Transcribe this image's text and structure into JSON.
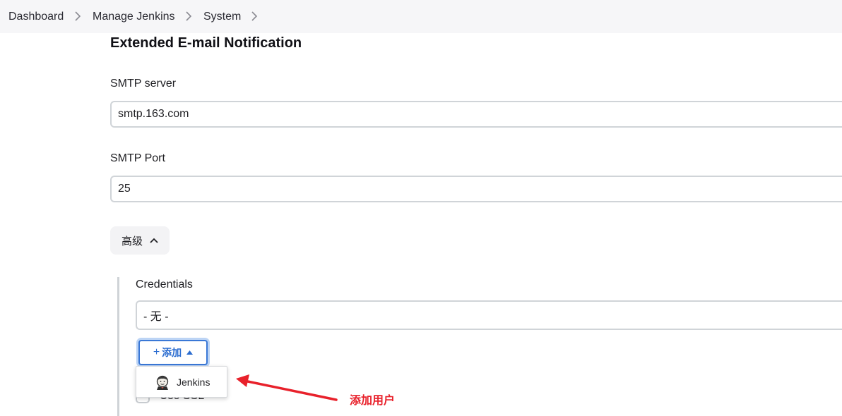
{
  "breadcrumb": [
    "Dashboard",
    "Manage Jenkins",
    "System"
  ],
  "section_title": "Extended E-mail Notification",
  "smtp_server": {
    "label": "SMTP server",
    "value": "smtp.163.com"
  },
  "smtp_port": {
    "label": "SMTP Port",
    "value": "25"
  },
  "advanced_button": "高级",
  "credentials": {
    "label": "Credentials",
    "value": "- 无 -"
  },
  "add_button": "添加",
  "use_ssl_label": "Use SSL",
  "dropdown": {
    "items": [
      {
        "label": "Jenkins",
        "icon": "jenkins-butler-icon"
      }
    ]
  },
  "annotation": {
    "text": "添加用户",
    "color": "#e8212b"
  },
  "colors": {
    "accent": "#3a78d6",
    "breadcrumb_bg": "#f6f6f8",
    "input_border": "#d0d4d8"
  }
}
